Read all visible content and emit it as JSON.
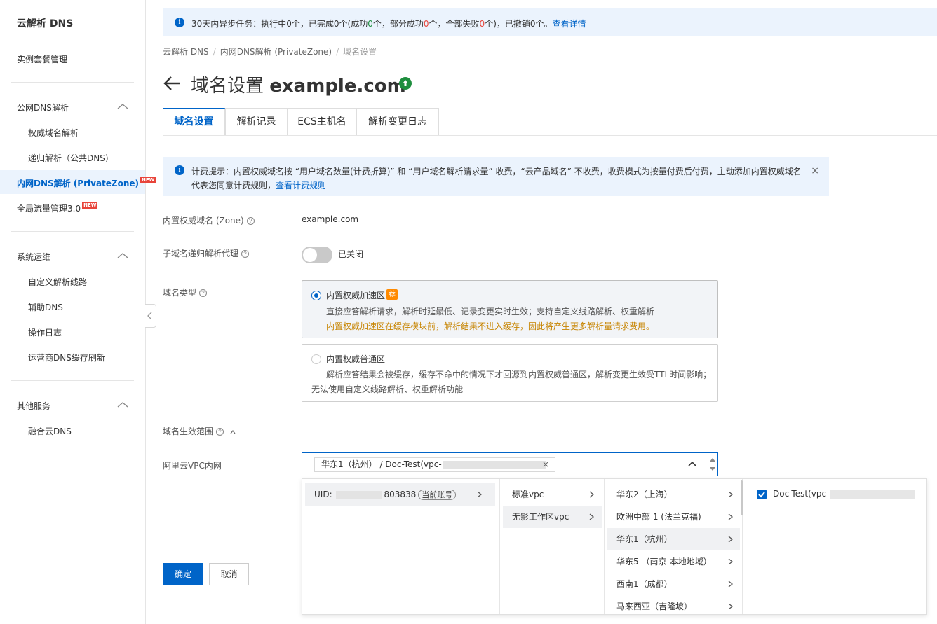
{
  "sidebar": {
    "title": "云解析 DNS",
    "instance_mgmt": "实例套餐管理",
    "group_public": "公网DNS解析",
    "auth_domain": "权威域名解析",
    "recursive": "递归解析（公共DNS)",
    "private_zone": "内网DNS解析 (PrivateZone)",
    "gtm": "全局流量管理3.0",
    "new_badge": "NEW",
    "group_ops": "系统运维",
    "custom_lines": "自定义解析线路",
    "aux_dns": "辅助DNS",
    "op_log": "操作日志",
    "isp_cache": "运营商DNS缓存刷新",
    "group_other": "其他服务",
    "fusion_dns": "融合云DNS"
  },
  "notice_top": {
    "prefix": "30天内异步任务：执行中0个，已完成0个(成功",
    "ok": "0",
    "mid1": "个，部分成功",
    "partial": "0",
    "mid2": "个，全部失败",
    "fail": "0",
    "suffix": "个)，已撤销0个。",
    "link": "查看详情"
  },
  "breadcrumb": [
    "云解析 DNS",
    "内网DNS解析 (PrivateZone)",
    "域名设置"
  ],
  "page": {
    "title_prefix": "域名设置",
    "title_domain": "example.com"
  },
  "tabs": [
    "域名设置",
    "解析记录",
    "ECS主机名",
    "解析变更日志"
  ],
  "bill_notice": {
    "text": "计费提示：内置权威域名按 “用户域名数量(计费折算)” 和 “用户域名解析请求量” 收费，“云产品域名” 不收费，收费模式为按量付费后付费，主动添加内置权威域名代表您同意计费规则，",
    "link": "查看计费规则",
    "close": "×"
  },
  "form": {
    "zone_label": "内置权威域名 (Zone)",
    "zone_value": "example.com",
    "recursive_label": "子域名递归解析代理",
    "recursive_state": "已关闭",
    "type_label": "域名类型",
    "scope_label": "域名生效范围",
    "vpc_label": "阿里云VPC内网"
  },
  "zone_types": [
    {
      "title": "内置权威加速区",
      "badge": "荐",
      "desc": "直接应答解析请求，解析时延最低、记录变更实时生效；支持自定义线路解析、权重解析",
      "warn": "内置权威加速区在缓存模块前，解析结果不进入缓存，因此将产生更多解析量请求费用。"
    },
    {
      "title": "内置权威普通区",
      "desc1": "解析应答结果会被缓存，缓存不命中的情况下才回源到内置权威普通区，解析变更生效受TTL时间影响；",
      "desc2": "无法使用自定义线路解析、权重解析功能"
    }
  ],
  "vpc_select": {
    "tag_text": "华东1（杭州） / Doc-Test(vpc-",
    "tag_close": "×"
  },
  "cascader": {
    "uid_prefix": "UID:",
    "uid_suffix": "803838",
    "account_tag": "当前账号",
    "vpc_types": [
      "标准vpc",
      "无影工作区vpc"
    ],
    "regions": [
      "华东2（上海）",
      "欧洲中部 1 (法兰克福)",
      "华东1（杭州）",
      "华东5 （南京-本地地域）",
      "西南1（成都）",
      "马来西亚（吉隆坡）"
    ],
    "vpc_item": "Doc-Test(vpc-"
  },
  "buttons": {
    "confirm": "确定",
    "cancel": "取消"
  },
  "colors": {
    "primary": "#0064c8",
    "notice_bg": "#ebf3fd",
    "warn": "#c78400",
    "error": "#e8443a",
    "success": "#1e8e3e"
  }
}
